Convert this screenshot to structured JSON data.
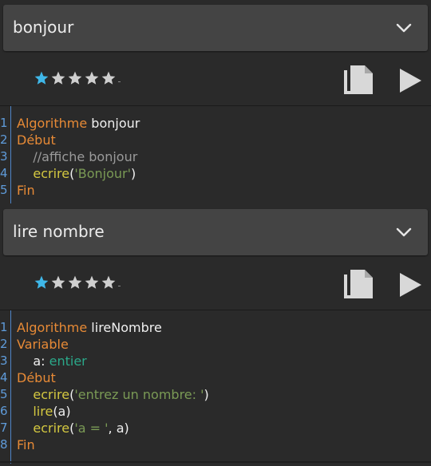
{
  "icons": {
    "chevron": "chevron-down-icon",
    "star": "star-icon",
    "copy": "copy-icon",
    "play": "play-icon"
  },
  "colors": {
    "keyword": "#e78a36",
    "function": "#d4c840",
    "string": "#7a9a55",
    "comment": "#9a9a9a",
    "type": "#2aa889",
    "line_number": "#5f9bd9",
    "star_active": "#3fb7e8",
    "star_inactive": "#cfcfcf"
  },
  "cards": [
    {
      "title": "bonjour",
      "rating": {
        "value": 1,
        "max": 5
      },
      "code": [
        {
          "n": "1",
          "tokens": [
            {
              "t": "Algorithme ",
              "c": "kw"
            },
            {
              "t": "bonjour",
              "c": "id"
            }
          ]
        },
        {
          "n": "2",
          "tokens": [
            {
              "t": "Début",
              "c": "kw"
            }
          ]
        },
        {
          "n": "3",
          "tokens": [
            {
              "t": "    //affiche bonjour",
              "c": "cmt"
            }
          ]
        },
        {
          "n": "4",
          "tokens": [
            {
              "t": "    ",
              "c": "id"
            },
            {
              "t": "ecrire",
              "c": "fn"
            },
            {
              "t": "(",
              "c": "id"
            },
            {
              "t": "'Bonjour'",
              "c": "str"
            },
            {
              "t": ")",
              "c": "id"
            }
          ]
        },
        {
          "n": "5",
          "tokens": [
            {
              "t": "Fin",
              "c": "kw"
            }
          ]
        }
      ]
    },
    {
      "title": "lire nombre",
      "rating": {
        "value": 1,
        "max": 5
      },
      "code": [
        {
          "n": "1",
          "tokens": [
            {
              "t": "Algorithme ",
              "c": "kw"
            },
            {
              "t": "lireNombre",
              "c": "id"
            }
          ]
        },
        {
          "n": "2",
          "tokens": [
            {
              "t": "Variable",
              "c": "kw"
            }
          ]
        },
        {
          "n": "3",
          "tokens": [
            {
              "t": "    a: ",
              "c": "id"
            },
            {
              "t": "entier",
              "c": "type"
            }
          ]
        },
        {
          "n": "4",
          "tokens": [
            {
              "t": "Début",
              "c": "kw"
            }
          ]
        },
        {
          "n": "5",
          "tokens": [
            {
              "t": "    ",
              "c": "id"
            },
            {
              "t": "ecrire",
              "c": "fn"
            },
            {
              "t": "(",
              "c": "id"
            },
            {
              "t": "'entrez un nombre: '",
              "c": "str"
            },
            {
              "t": ")",
              "c": "id"
            }
          ]
        },
        {
          "n": "6",
          "tokens": [
            {
              "t": "    ",
              "c": "id"
            },
            {
              "t": "lire",
              "c": "fn"
            },
            {
              "t": "(a)",
              "c": "id"
            }
          ]
        },
        {
          "n": "7",
          "tokens": [
            {
              "t": "    ",
              "c": "id"
            },
            {
              "t": "ecrire",
              "c": "fn"
            },
            {
              "t": "(",
              "c": "id"
            },
            {
              "t": "'a = '",
              "c": "str"
            },
            {
              "t": ", a)",
              "c": "id"
            }
          ]
        },
        {
          "n": "8",
          "tokens": [
            {
              "t": "Fin",
              "c": "kw"
            }
          ]
        }
      ]
    }
  ]
}
